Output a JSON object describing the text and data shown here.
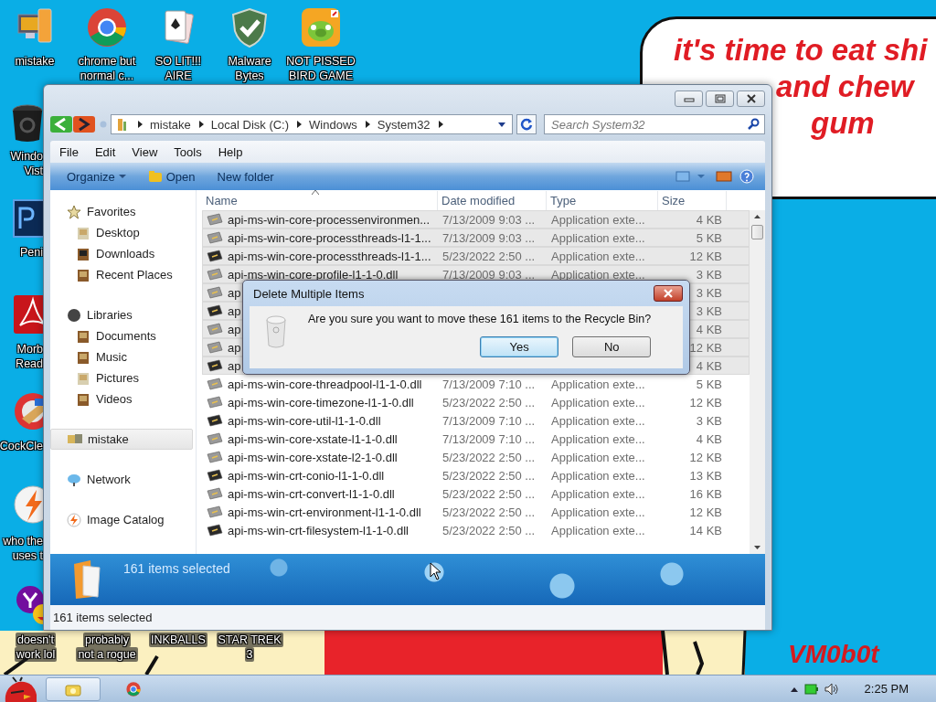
{
  "desktop": {
    "icons": [
      {
        "kind": "computer",
        "lines": [
          "mistake"
        ]
      },
      {
        "kind": "chrome",
        "lines": [
          "chrome but",
          "normal c..."
        ]
      },
      {
        "kind": "cards",
        "lines": [
          "SO LIT!!!",
          "AIRE"
        ]
      },
      {
        "kind": "shield",
        "lines": [
          "Malware",
          "Bytes"
        ]
      },
      {
        "kind": "pig",
        "lines": [
          "NOT PISSED",
          "BIRD GAME"
        ]
      },
      {
        "kind": "trash",
        "lines": [
          "Windo",
          "Vist"
        ]
      },
      {
        "kind": "ps",
        "lines": [
          "Peni"
        ]
      },
      {
        "kind": "pdf",
        "lines": [
          "Morb",
          "Read"
        ]
      },
      {
        "kind": "cleaner",
        "lines": [
          "CockCle"
        ]
      },
      {
        "kind": "bolt",
        "lines": [
          "who the",
          "uses t"
        ]
      },
      {
        "kind": "yahoo",
        "lines": [
          "doesn't",
          "work lol"
        ]
      },
      {
        "kind": "covered",
        "lines": [
          "probably",
          "not a rogue"
        ]
      },
      {
        "kind": "covered",
        "lines": [
          "INKBALLS"
        ]
      },
      {
        "kind": "covered",
        "lines": [
          "STAR TREK",
          "3"
        ]
      }
    ],
    "wallpaper": {
      "bubble_lines": [
        "it's time to eat shi",
        "and chew",
        "gum"
      ],
      "signature": "VM0b0t"
    }
  },
  "explorer": {
    "breadcrumbs": [
      "mistake",
      "Local Disk (C:)",
      "Windows",
      "System32"
    ],
    "search": {
      "placeholder": "Search System32"
    },
    "menu": [
      "File",
      "Edit",
      "View",
      "Tools",
      "Help"
    ],
    "toolbar": [
      {
        "kind": "dropdown",
        "label": "Organize"
      },
      {
        "kind": "open",
        "label": "Open"
      },
      {
        "kind": "plain",
        "label": "New folder"
      }
    ],
    "nav": [
      {
        "label": "Favorites",
        "kind": "star",
        "selected": false,
        "children": [
          {
            "label": "Desktop",
            "kind": "desktop"
          },
          {
            "label": "Downloads",
            "kind": "downloads"
          },
          {
            "label": "Recent Places",
            "kind": "recent"
          }
        ]
      },
      {
        "label": "Libraries",
        "kind": "libraries",
        "selected": false,
        "children": [
          {
            "label": "Documents",
            "kind": "documents"
          },
          {
            "label": "Music",
            "kind": "music"
          },
          {
            "label": "Pictures",
            "kind": "pictures"
          },
          {
            "label": "Videos",
            "kind": "videos"
          }
        ]
      },
      {
        "label": "mistake",
        "kind": "homegroup",
        "selected": true
      },
      {
        "label": "Network",
        "kind": "network",
        "selected": false
      },
      {
        "label": "Image Catalog",
        "kind": "bolt",
        "selected": false
      }
    ],
    "columns": [
      "Name",
      "Date modified",
      "Type",
      "Size"
    ],
    "rows": [
      {
        "name": "api-ms-win-core-processenvironmen...",
        "date": "7/13/2009 9:03 ...",
        "type": "Application exte...",
        "size": "4 KB",
        "selected": true
      },
      {
        "name": "api-ms-win-core-processthreads-l1-1...",
        "date": "7/13/2009 9:03 ...",
        "type": "Application exte...",
        "size": "5 KB",
        "selected": true
      },
      {
        "name": "api-ms-win-core-processthreads-l1-1...",
        "date": "5/23/2022 2:50 ...",
        "type": "Application exte...",
        "size": "12 KB",
        "selected": true
      },
      {
        "name": "api-ms-win-core-profile-l1-1-0.dll",
        "date": "7/13/2009 9:03 ...",
        "type": "Application exte...",
        "size": "3 KB",
        "selected": true
      },
      {
        "name": "ap",
        "size": "3 KB",
        "selected": true
      },
      {
        "name": "ap",
        "size": "3 KB",
        "selected": true
      },
      {
        "name": "ap",
        "size": "4 KB",
        "selected": true
      },
      {
        "name": "ap",
        "size": "12 KB",
        "selected": true
      },
      {
        "name": "ap",
        "size": "4 KB",
        "selected": true
      },
      {
        "name": "api-ms-win-core-threadpool-l1-1-0.dll",
        "date": "7/13/2009 7:10 ...",
        "type": "Application exte...",
        "size": "5 KB",
        "selected": false
      },
      {
        "name": "api-ms-win-core-timezone-l1-1-0.dll",
        "date": "5/23/2022 2:50 ...",
        "type": "Application exte...",
        "size": "12 KB",
        "selected": false
      },
      {
        "name": "api-ms-win-core-util-l1-1-0.dll",
        "date": "7/13/2009 7:10 ...",
        "type": "Application exte...",
        "size": "3 KB",
        "selected": false
      },
      {
        "name": "api-ms-win-core-xstate-l1-1-0.dll",
        "date": "7/13/2009 7:10 ...",
        "type": "Application exte...",
        "size": "4 KB",
        "selected": false
      },
      {
        "name": "api-ms-win-core-xstate-l2-1-0.dll",
        "date": "5/23/2022 2:50 ...",
        "type": "Application exte...",
        "size": "12 KB",
        "selected": false
      },
      {
        "name": "api-ms-win-crt-conio-l1-1-0.dll",
        "date": "5/23/2022 2:50 ...",
        "type": "Application exte...",
        "size": "13 KB",
        "selected": false
      },
      {
        "name": "api-ms-win-crt-convert-l1-1-0.dll",
        "date": "5/23/2022 2:50 ...",
        "type": "Application exte...",
        "size": "16 KB",
        "selected": false
      },
      {
        "name": "api-ms-win-crt-environment-l1-1-0.dll",
        "date": "5/23/2022 2:50 ...",
        "type": "Application exte...",
        "size": "12 KB",
        "selected": false
      },
      {
        "name": "api-ms-win-crt-filesystem-l1-1-0.dll",
        "date": "5/23/2022 2:50 ...",
        "type": "Application exte...",
        "size": "14 KB",
        "selected": false
      }
    ],
    "details": "161 items selected",
    "status": "161 items selected"
  },
  "dialog": {
    "title": "Delete Multiple Items",
    "message": "Are you sure you want to move these 161 items to the Recycle Bin?",
    "buttons": [
      {
        "label": "Yes",
        "selected": true
      },
      {
        "label": "No",
        "selected": false
      }
    ]
  },
  "taskbar": {
    "items": [
      {
        "kind": "explorer",
        "selected": true
      },
      {
        "kind": "chrome",
        "selected": false
      }
    ],
    "clock": "2:25 PM"
  }
}
